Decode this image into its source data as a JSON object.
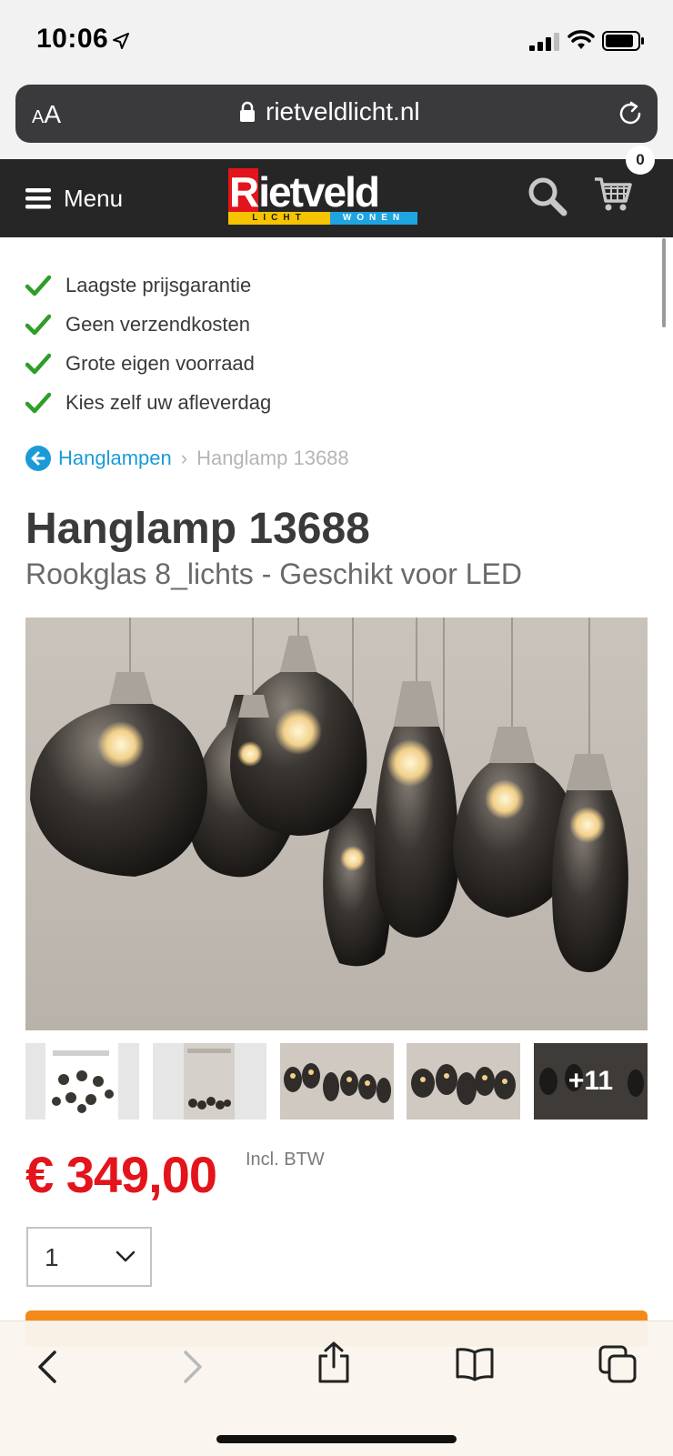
{
  "status_bar": {
    "time": "10:06"
  },
  "browser": {
    "text_size_label_small": "A",
    "text_size_label_large": "A",
    "domain": "rietveldlicht.nl"
  },
  "header": {
    "menu_label": "Menu",
    "logo_text_first": "R",
    "logo_text_rest": "ietveld",
    "logo_strip_left": "LICHT",
    "logo_strip_right": "WONEN",
    "cart_count": "0"
  },
  "usps": [
    "Laagste prijsgarantie",
    "Geen verzendkosten",
    "Grote eigen voorraad",
    "Kies zelf uw afleverdag"
  ],
  "breadcrumb": {
    "parent": "Hanglampen",
    "separator": "›",
    "current": "Hanglamp 13688"
  },
  "product": {
    "title": "Hanglamp 13688",
    "subtitle": "Rookglas 8_lichts - Geschikt voor LED",
    "price": "€ 349,00",
    "vat_note": "Incl. BTW",
    "quantity": "1",
    "more_images": "+11"
  },
  "colors": {
    "brand_red": "#e3141b",
    "link_blue": "#1a9bd7",
    "check_green": "#2e9e27",
    "cta_orange": "#f38a1a",
    "header_dark": "#262626"
  },
  "icons": [
    "location-arrow-icon",
    "signal-icon",
    "wifi-icon",
    "battery-icon",
    "lock-icon",
    "reload-icon",
    "hamburger-icon",
    "search-icon",
    "cart-icon",
    "checkmark-icon",
    "back-circle-icon",
    "chevron-right-icon",
    "chevron-down-icon",
    "back-icon",
    "forward-icon",
    "share-icon",
    "bookmarks-icon",
    "tabs-icon"
  ]
}
